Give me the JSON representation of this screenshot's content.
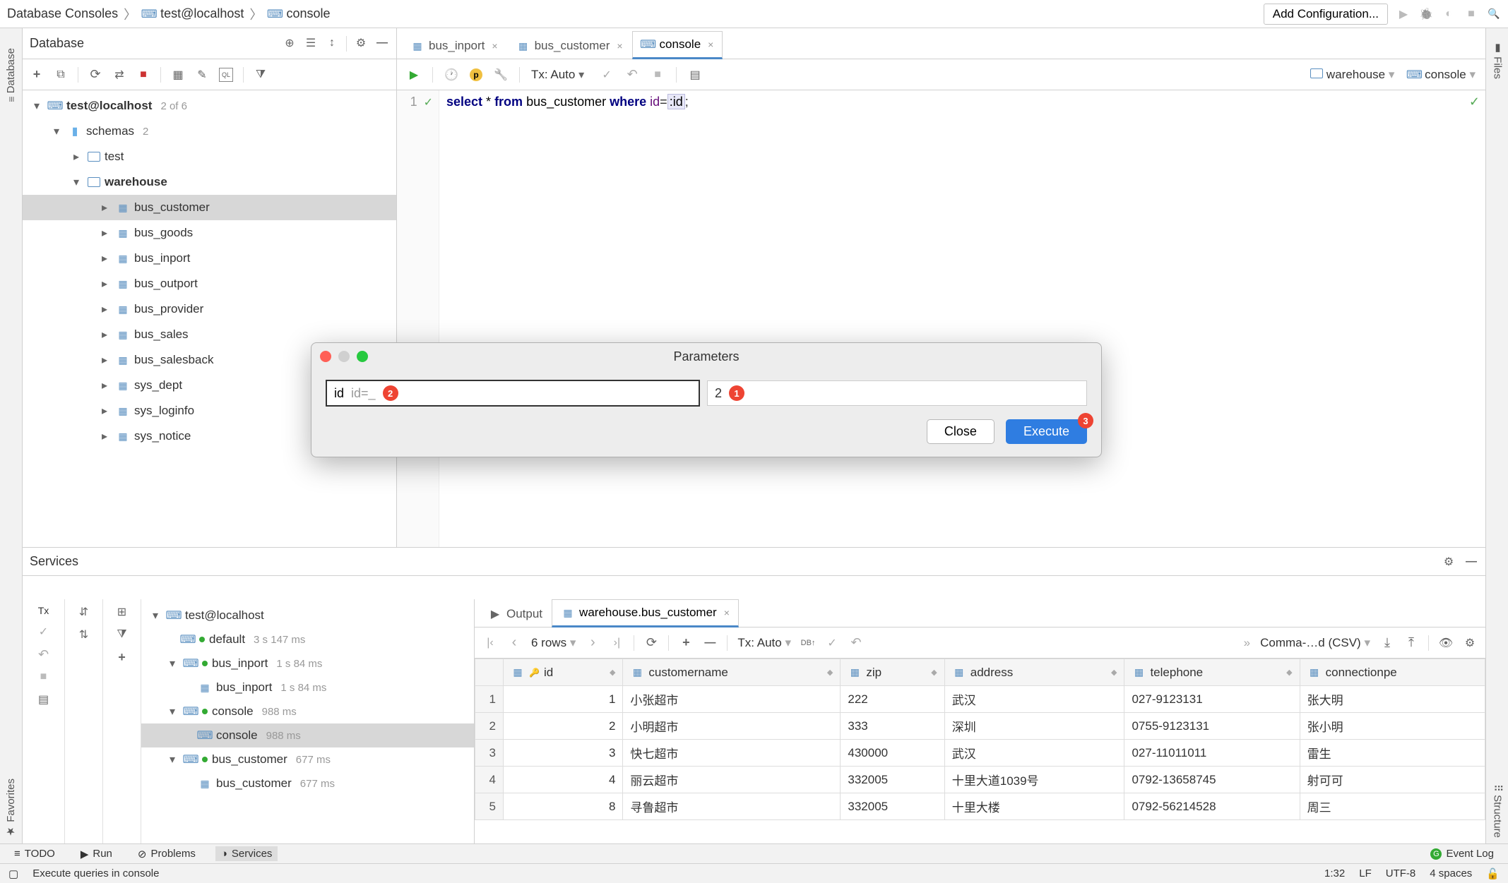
{
  "breadcrumb": {
    "a": "Database Consoles",
    "b": "test@localhost",
    "c": "console"
  },
  "topbar": {
    "config": "Add Configuration..."
  },
  "leftStripe": {
    "db": "Database",
    "fav": "Favorites"
  },
  "rightStripe": {
    "files": "Files",
    "structure": "Structure"
  },
  "dbPanel": {
    "title": "Database",
    "root": "test@localhost",
    "rootCount": "2 of 6",
    "schemas": "schemas",
    "schemasCount": "2",
    "schema_test": "test",
    "schema_wh": "warehouse",
    "tables": [
      "bus_customer",
      "bus_goods",
      "bus_inport",
      "bus_outport",
      "bus_provider",
      "bus_sales",
      "bus_salesback",
      "sys_dept",
      "sys_loginfo",
      "sys_notice"
    ]
  },
  "editor": {
    "tabs": {
      "t1": "bus_inport",
      "t2": "bus_customer",
      "t3": "console"
    },
    "tx": "Tx: Auto",
    "target_db": "warehouse",
    "target_conn": "console",
    "lineno": "1",
    "sql": {
      "select": "select",
      "star": " * ",
      "from": "from",
      "table": " bus_customer ",
      "where": "where",
      "col": " id",
      "eq": "=",
      "param": ":id",
      "end": ";"
    }
  },
  "dialog": {
    "title": "Parameters",
    "param_name": "id",
    "param_expr": "id=_",
    "badge2": "2",
    "param_value": "2",
    "badge1": "1",
    "close": "Close",
    "execute": "Execute",
    "badge3": "3"
  },
  "services": {
    "title": "Services",
    "tx": "Tx",
    "tree": {
      "root": "test@localhost",
      "i1": "default",
      "t1": "3 s 147 ms",
      "i2": "bus_inport",
      "t2": "1 s 84 ms",
      "i2s": "bus_inport",
      "t2s": "1 s 84 ms",
      "i3": "console",
      "t3": "988 ms",
      "i3s": "console",
      "t3s": "988 ms",
      "i4": "bus_customer",
      "t4": "677 ms",
      "i4s": "bus_customer",
      "t4s": "677 ms"
    },
    "tabs": {
      "out": "Output",
      "res": "warehouse.bus_customer"
    },
    "rows_label": "6 rows",
    "tx2": "Tx: Auto",
    "export": "Comma-…d (CSV)",
    "columns": {
      "c1": "id",
      "c2": "customername",
      "c3": "zip",
      "c4": "address",
      "c5": "telephone",
      "c6": "connectionpe"
    },
    "data": [
      {
        "n": "1",
        "id": "1",
        "name": "小张超市",
        "zip": "222",
        "addr": "武汉",
        "tel": "027-9123131",
        "conn": "张大明"
      },
      {
        "n": "2",
        "id": "2",
        "name": "小明超市",
        "zip": "333",
        "addr": "深圳",
        "tel": "0755-9123131",
        "conn": "张小明"
      },
      {
        "n": "3",
        "id": "3",
        "name": "快七超市",
        "zip": "430000",
        "addr": "武汉",
        "tel": "027-11011011",
        "conn": "雷生"
      },
      {
        "n": "4",
        "id": "4",
        "name": "丽云超市",
        "zip": "332005",
        "addr": "十里大道1039号",
        "tel": "0792-13658745",
        "conn": "射可可"
      },
      {
        "n": "5",
        "id": "8",
        "name": "寻鲁超市",
        "zip": "332005",
        "addr": "十里大楼",
        "tel": "0792-56214528",
        "conn": "周三"
      }
    ]
  },
  "footbar1": {
    "todo": "TODO",
    "run": "Run",
    "problems": "Problems",
    "services": "Services",
    "eventlog": "Event Log"
  },
  "footbar2": {
    "hint": "Execute queries in console",
    "pos": "1:32",
    "lf": "LF",
    "enc": "UTF-8",
    "indent": "4 spaces"
  }
}
